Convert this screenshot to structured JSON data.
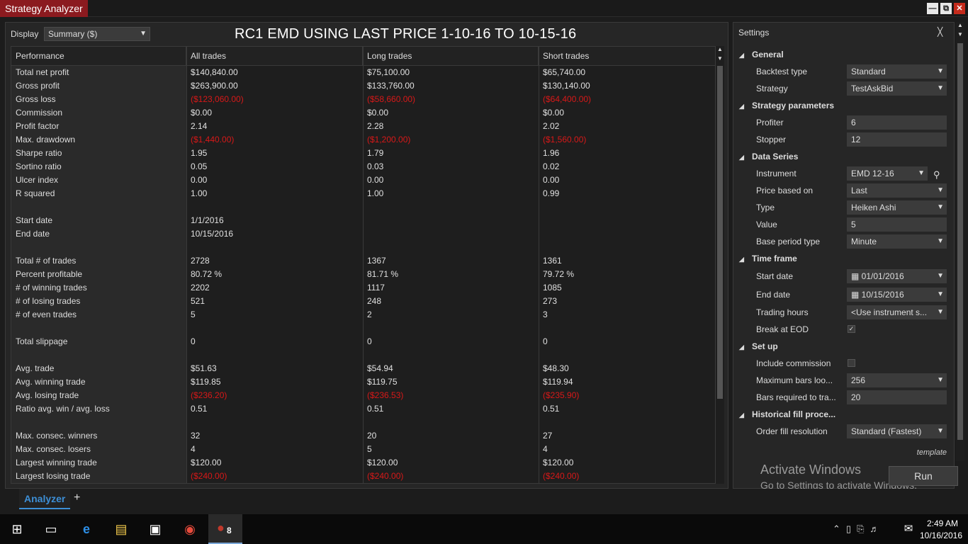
{
  "window": {
    "title": "Strategy Analyzer",
    "minimize_glyph": "—",
    "restore_glyph": "⧉",
    "close_glyph": "✕"
  },
  "display": {
    "label": "Display",
    "value": "Summary ($)"
  },
  "report_title": "RC1 EMD USING LAST PRICE 1-10-16 TO 10-15-16",
  "table": {
    "headers": [
      "Performance",
      "All trades",
      "Long trades",
      "Short trades"
    ],
    "rows": [
      {
        "label": "Total net profit",
        "all": "$140,840.00",
        "long": "$75,100.00",
        "short": "$65,740.00",
        "negative": false
      },
      {
        "label": "Gross profit",
        "all": "$263,900.00",
        "long": "$133,760.00",
        "short": "$130,140.00",
        "negative": false
      },
      {
        "label": "Gross loss",
        "all": "($123,060.00)",
        "long": "($58,660.00)",
        "short": "($64,400.00)",
        "negative": true
      },
      {
        "label": "Commission",
        "all": "$0.00",
        "long": "$0.00",
        "short": "$0.00",
        "negative": false
      },
      {
        "label": "Profit factor",
        "all": "2.14",
        "long": "2.28",
        "short": "2.02",
        "negative": false
      },
      {
        "label": "Max. drawdown",
        "all": "($1,440.00)",
        "long": "($1,200.00)",
        "short": "($1,560.00)",
        "negative": true
      },
      {
        "label": "Sharpe ratio",
        "all": "1.95",
        "long": "1.79",
        "short": "1.96",
        "negative": false
      },
      {
        "label": "Sortino ratio",
        "all": "0.05",
        "long": "0.03",
        "short": "0.02",
        "negative": false
      },
      {
        "label": "Ulcer index",
        "all": "0.00",
        "long": "0.00",
        "short": "0.00",
        "negative": false
      },
      {
        "label": "R squared",
        "all": "1.00",
        "long": "1.00",
        "short": "0.99",
        "negative": false
      },
      {
        "label": "",
        "all": "",
        "long": "",
        "short": "",
        "negative": false
      },
      {
        "label": "Start date",
        "all": "1/1/2016",
        "long": "",
        "short": "",
        "negative": false
      },
      {
        "label": "End date",
        "all": "10/15/2016",
        "long": "",
        "short": "",
        "negative": false
      },
      {
        "label": "",
        "all": "",
        "long": "",
        "short": "",
        "negative": false
      },
      {
        "label": "Total # of trades",
        "all": "2728",
        "long": "1367",
        "short": "1361",
        "negative": false
      },
      {
        "label": "Percent profitable",
        "all": "80.72 %",
        "long": "81.71 %",
        "short": "79.72 %",
        "negative": false
      },
      {
        "label": "# of winning trades",
        "all": "2202",
        "long": "1117",
        "short": "1085",
        "negative": false
      },
      {
        "label": "# of losing trades",
        "all": "521",
        "long": "248",
        "short": "273",
        "negative": false
      },
      {
        "label": "# of even trades",
        "all": "5",
        "long": "2",
        "short": "3",
        "negative": false
      },
      {
        "label": "",
        "all": "",
        "long": "",
        "short": "",
        "negative": false
      },
      {
        "label": "Total slippage",
        "all": "0",
        "long": "0",
        "short": "0",
        "negative": false
      },
      {
        "label": "",
        "all": "",
        "long": "",
        "short": "",
        "negative": false
      },
      {
        "label": "Avg. trade",
        "all": "$51.63",
        "long": "$54.94",
        "short": "$48.30",
        "negative": false
      },
      {
        "label": "Avg. winning trade",
        "all": "$119.85",
        "long": "$119.75",
        "short": "$119.94",
        "negative": false
      },
      {
        "label": "Avg. losing trade",
        "all": "($236.20)",
        "long": "($236.53)",
        "short": "($235.90)",
        "negative": true
      },
      {
        "label": "Ratio avg. win / avg. loss",
        "all": "0.51",
        "long": "0.51",
        "short": "0.51",
        "negative": false
      },
      {
        "label": "",
        "all": "",
        "long": "",
        "short": "",
        "negative": false
      },
      {
        "label": "Max. consec. winners",
        "all": "32",
        "long": "20",
        "short": "27",
        "negative": false
      },
      {
        "label": "Max. consec. losers",
        "all": "4",
        "long": "5",
        "short": "4",
        "negative": false
      },
      {
        "label": "Largest winning trade",
        "all": "$120.00",
        "long": "$120.00",
        "short": "$120.00",
        "negative": false
      },
      {
        "label": "Largest losing trade",
        "all": "($240.00)",
        "long": "($240.00)",
        "short": "($240.00)",
        "negative": true
      }
    ]
  },
  "settings": {
    "title": "Settings",
    "pin_icon": "pin-icon",
    "sections": {
      "general": "General",
      "strategy_parameters": "Strategy parameters",
      "data_series": "Data Series",
      "time_frame": "Time frame",
      "set_up": "Set up",
      "historical_fill": "Historical fill proce..."
    },
    "backtest_type": {
      "label": "Backtest type",
      "value": "Standard"
    },
    "strategy": {
      "label": "Strategy",
      "value": "TestAskBid"
    },
    "profiter": {
      "label": "Profiter",
      "value": "6"
    },
    "stopper": {
      "label": "Stopper",
      "value": "12"
    },
    "instrument": {
      "label": "Instrument",
      "value": "EMD 12-16"
    },
    "price_based_on": {
      "label": "Price based on",
      "value": "Last"
    },
    "type": {
      "label": "Type",
      "value": "Heiken Ashi"
    },
    "value": {
      "label": "Value",
      "value": "5"
    },
    "base_period_type": {
      "label": "Base period type",
      "value": "Minute"
    },
    "start_date": {
      "label": "Start date",
      "value": "01/01/2016"
    },
    "end_date": {
      "label": "End date",
      "value": "10/15/2016"
    },
    "trading_hours": {
      "label": "Trading hours",
      "value": "<Use instrument s..."
    },
    "break_at_eod": {
      "label": "Break at EOD",
      "checked": true
    },
    "include_commission": {
      "label": "Include commission",
      "checked": false
    },
    "max_bars": {
      "label": "Maximum bars loo...",
      "value": "256"
    },
    "bars_required": {
      "label": "Bars required to tra...",
      "value": "20"
    },
    "order_fill_resolution": {
      "label": "Order fill resolution",
      "value": "Standard (Fastest)"
    },
    "template_link": "template",
    "run_button": "Run"
  },
  "watermark": {
    "title": "Activate Windows",
    "subtitle": "Go to Settings to activate Windows."
  },
  "tabs": {
    "analyzer": "Analyzer",
    "add": "+"
  },
  "taskbar": {
    "time": "2:49 AM",
    "date": "10/16/2016",
    "app_badge": "8"
  }
}
